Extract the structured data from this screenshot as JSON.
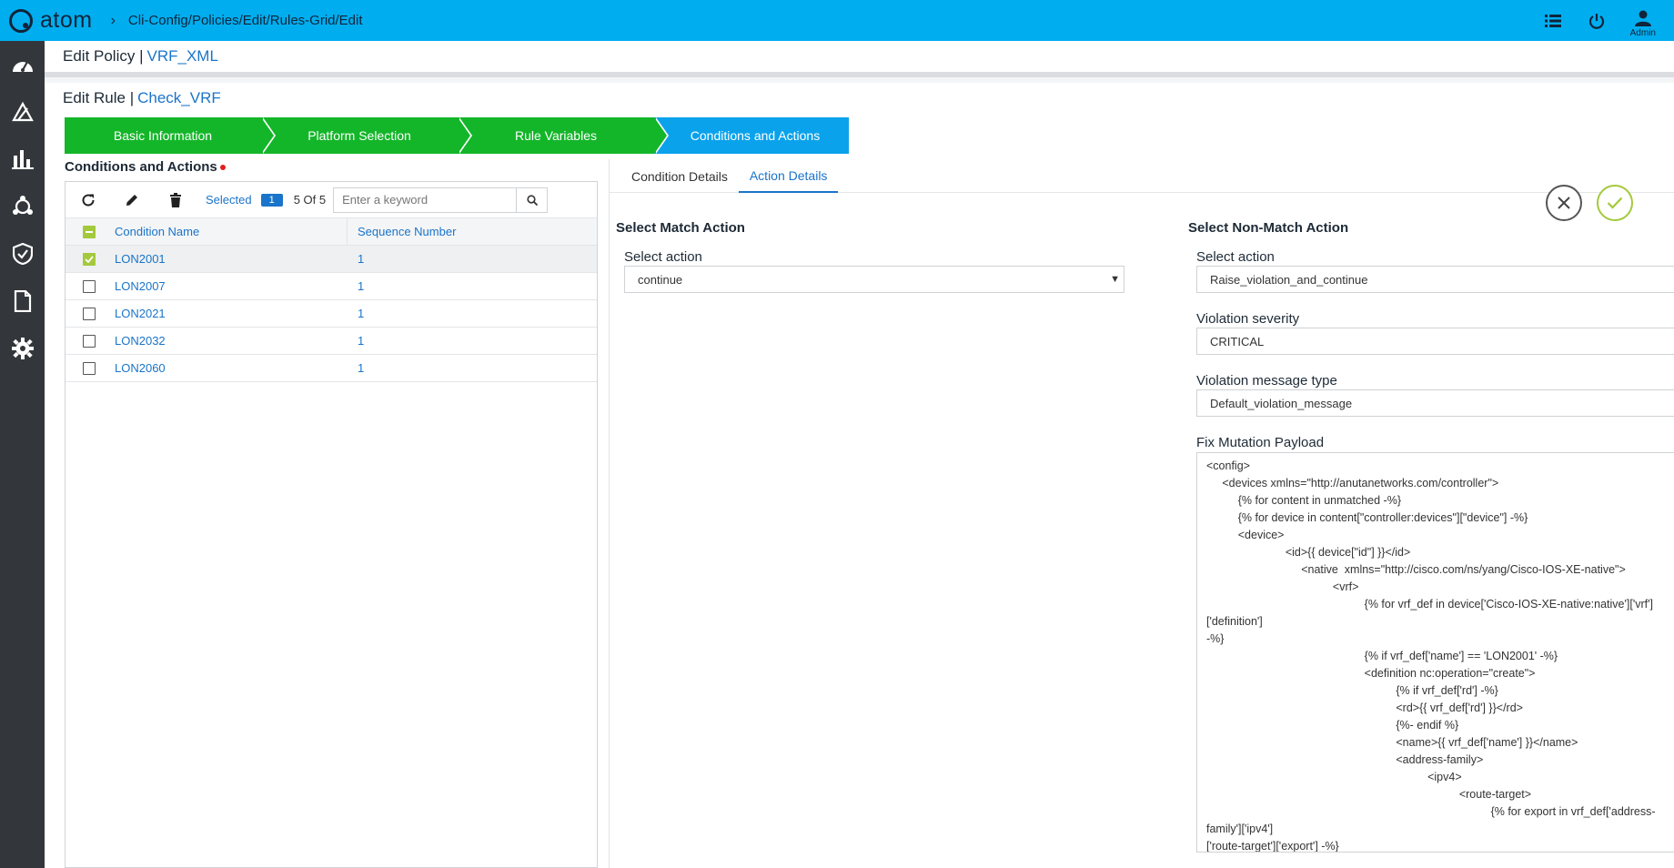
{
  "app": {
    "logo_text": "atom",
    "breadcrumb": "Cli-Config/Policies/Edit/Rules-Grid/Edit",
    "user_label": "Admin"
  },
  "policy": {
    "label": "Edit Policy |",
    "name": "VRF_XML"
  },
  "rule": {
    "label": "Edit Rule |",
    "name": "Check_VRF"
  },
  "steps": [
    {
      "label": "Basic Information",
      "state": "done"
    },
    {
      "label": "Platform Selection",
      "state": "done"
    },
    {
      "label": "Rule Variables",
      "state": "done"
    },
    {
      "label": "Conditions and Actions",
      "state": "active"
    }
  ],
  "conditions": {
    "title": "Conditions and Actions",
    "selected_label": "Selected",
    "selected_count": "1",
    "count_label": "5 Of 5",
    "search_placeholder": "Enter a keyword",
    "columns": [
      "Condition Name",
      "Sequence Number"
    ],
    "rows": [
      {
        "name": "LON2001",
        "seq": "1",
        "checked": true
      },
      {
        "name": "LON2007",
        "seq": "1",
        "checked": false
      },
      {
        "name": "LON2021",
        "seq": "1",
        "checked": false
      },
      {
        "name": "LON2032",
        "seq": "1",
        "checked": false
      },
      {
        "name": "LON2060",
        "seq": "1",
        "checked": false
      }
    ]
  },
  "detail": {
    "tabs": [
      "Condition Details",
      "Action Details"
    ],
    "active_tab": "Action Details",
    "match": {
      "title": "Select Match Action",
      "action_label": "Select action",
      "action_value": "continue"
    },
    "non_match": {
      "title": "Select Non-Match Action",
      "action_label": "Select action",
      "action_value": "Raise_violation_and_continue",
      "severity_label": "Violation severity",
      "severity_value": "CRITICAL",
      "msg_type_label": "Violation message type",
      "msg_type_value": "Default_violation_message",
      "payload_label": "Fix Mutation Payload",
      "payload": "<config>\n     <devices xmlns=\"http://anutanetworks.com/controller\">\n          {% for content in unmatched -%}\n          {% for device in content[\"controller:devices\"][\"device\"] -%}\n          <device>\n                         <id>{{ device[\"id\"] }}</id>\n                              <native  xmlns=\"http://cisco.com/ns/yang/Cisco-IOS-XE-native\">\n                                        <vrf>\n                                                  {% for vrf_def in device['Cisco-IOS-XE-native:native']['vrf']['definition']\n-%}\n                                                  {% if vrf_def['name'] == 'LON2001' -%}\n                                                  <definition nc:operation=\"create\">\n                                                            {% if vrf_def['rd'] -%}\n                                                            <rd>{{ vrf_def['rd'] }}</rd>\n                                                            {%- endif %}\n                                                            <name>{{ vrf_def['name'] }}</name>\n                                                            <address-family>\n                                                                      <ipv4>\n                                                                                <route-target>\n                                                                                          {% for export in vrf_def['address-family']['ipv4']\n['route-target']['export'] -%}\n                                                                                          <export>\n                                                                                                    <asn-ip>{{ export['asn-ip'] }}</asn-ip>"
    }
  },
  "colors": {
    "topbar": "#00aeef",
    "sidebar": "#33373b",
    "step_done": "#14b629",
    "step_active": "#0aa2eb",
    "link": "#1a74c9",
    "check": "#a4c93c"
  },
  "icons": {
    "sidebar": [
      "dashboard-icon",
      "deploy-icon",
      "reports-icon",
      "topology-icon",
      "security-icon",
      "documents-icon",
      "settings-icon"
    ],
    "top": [
      "list-icon",
      "power-icon",
      "user-icon"
    ]
  }
}
